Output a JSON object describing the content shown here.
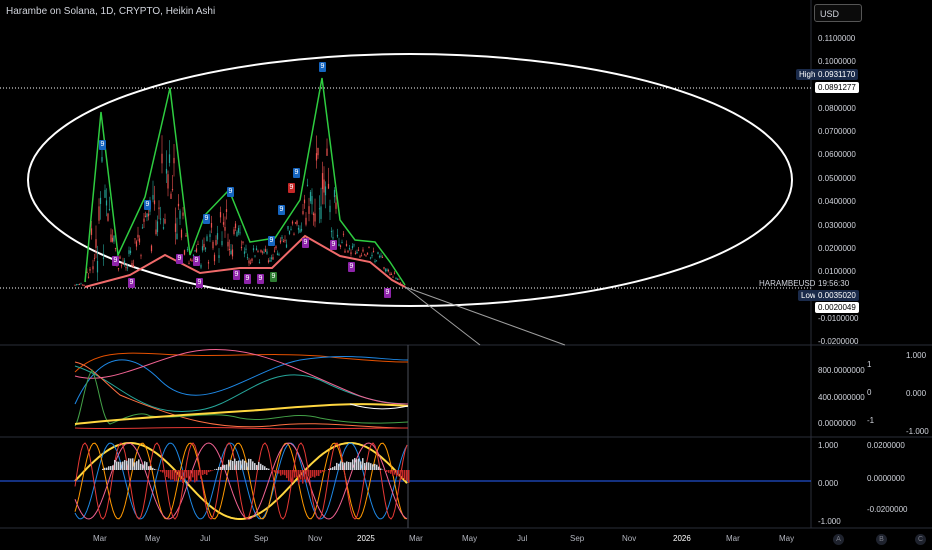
{
  "header": {
    "title": "Harambe on Solana, 1D, CRYPTO, Heikin Ashi",
    "currency": "USD"
  },
  "price_axis": {
    "ticks": [
      "0.1100000",
      "0.1000000",
      "0.0800000",
      "0.0700000",
      "0.0600000",
      "0.0500000",
      "0.0400000",
      "0.0300000",
      "0.0200000",
      "0.0100000",
      "-0.0100000",
      "-0.0200000"
    ],
    "high_label": "High",
    "high_value": "0.0931170",
    "high_line_value": "0.0891277",
    "symbol_label": "HARAMBEUSD",
    "countdown": "19:56:30",
    "low_label": "Low",
    "low_value": "0.0035020",
    "current_value": "0.0020049"
  },
  "pane1": {
    "ticks_left": [
      "800.0000000",
      "400.0000000",
      "0.0000000"
    ],
    "ticks_mid": [
      "1",
      "0",
      "-1"
    ],
    "ticks_right": [
      "1.000",
      "0.000",
      "-1.000"
    ]
  },
  "pane2": {
    "ticks_left": [
      "1.000",
      "0.000",
      "-1.000"
    ],
    "ticks_right": [
      "0.0200000",
      "0.0000000",
      "-0.0200000"
    ]
  },
  "time_axis": {
    "labels": [
      "Mar",
      "May",
      "Jul",
      "Sep",
      "Nov",
      "2025",
      "Mar",
      "May",
      "Jul",
      "Sep",
      "Nov",
      "2026",
      "Mar",
      "May"
    ]
  },
  "bottom_buttons": [
    "A",
    "B",
    "C"
  ],
  "markers": {
    "nine": "9"
  },
  "colors": {
    "background": "#000000",
    "up": "#26a69a",
    "down": "#ef5350",
    "zigzag_high": "#2ecc40",
    "zigzag_low": "#f06a6a",
    "ellipse": "#ffffff",
    "sine": "#ffd740"
  }
}
